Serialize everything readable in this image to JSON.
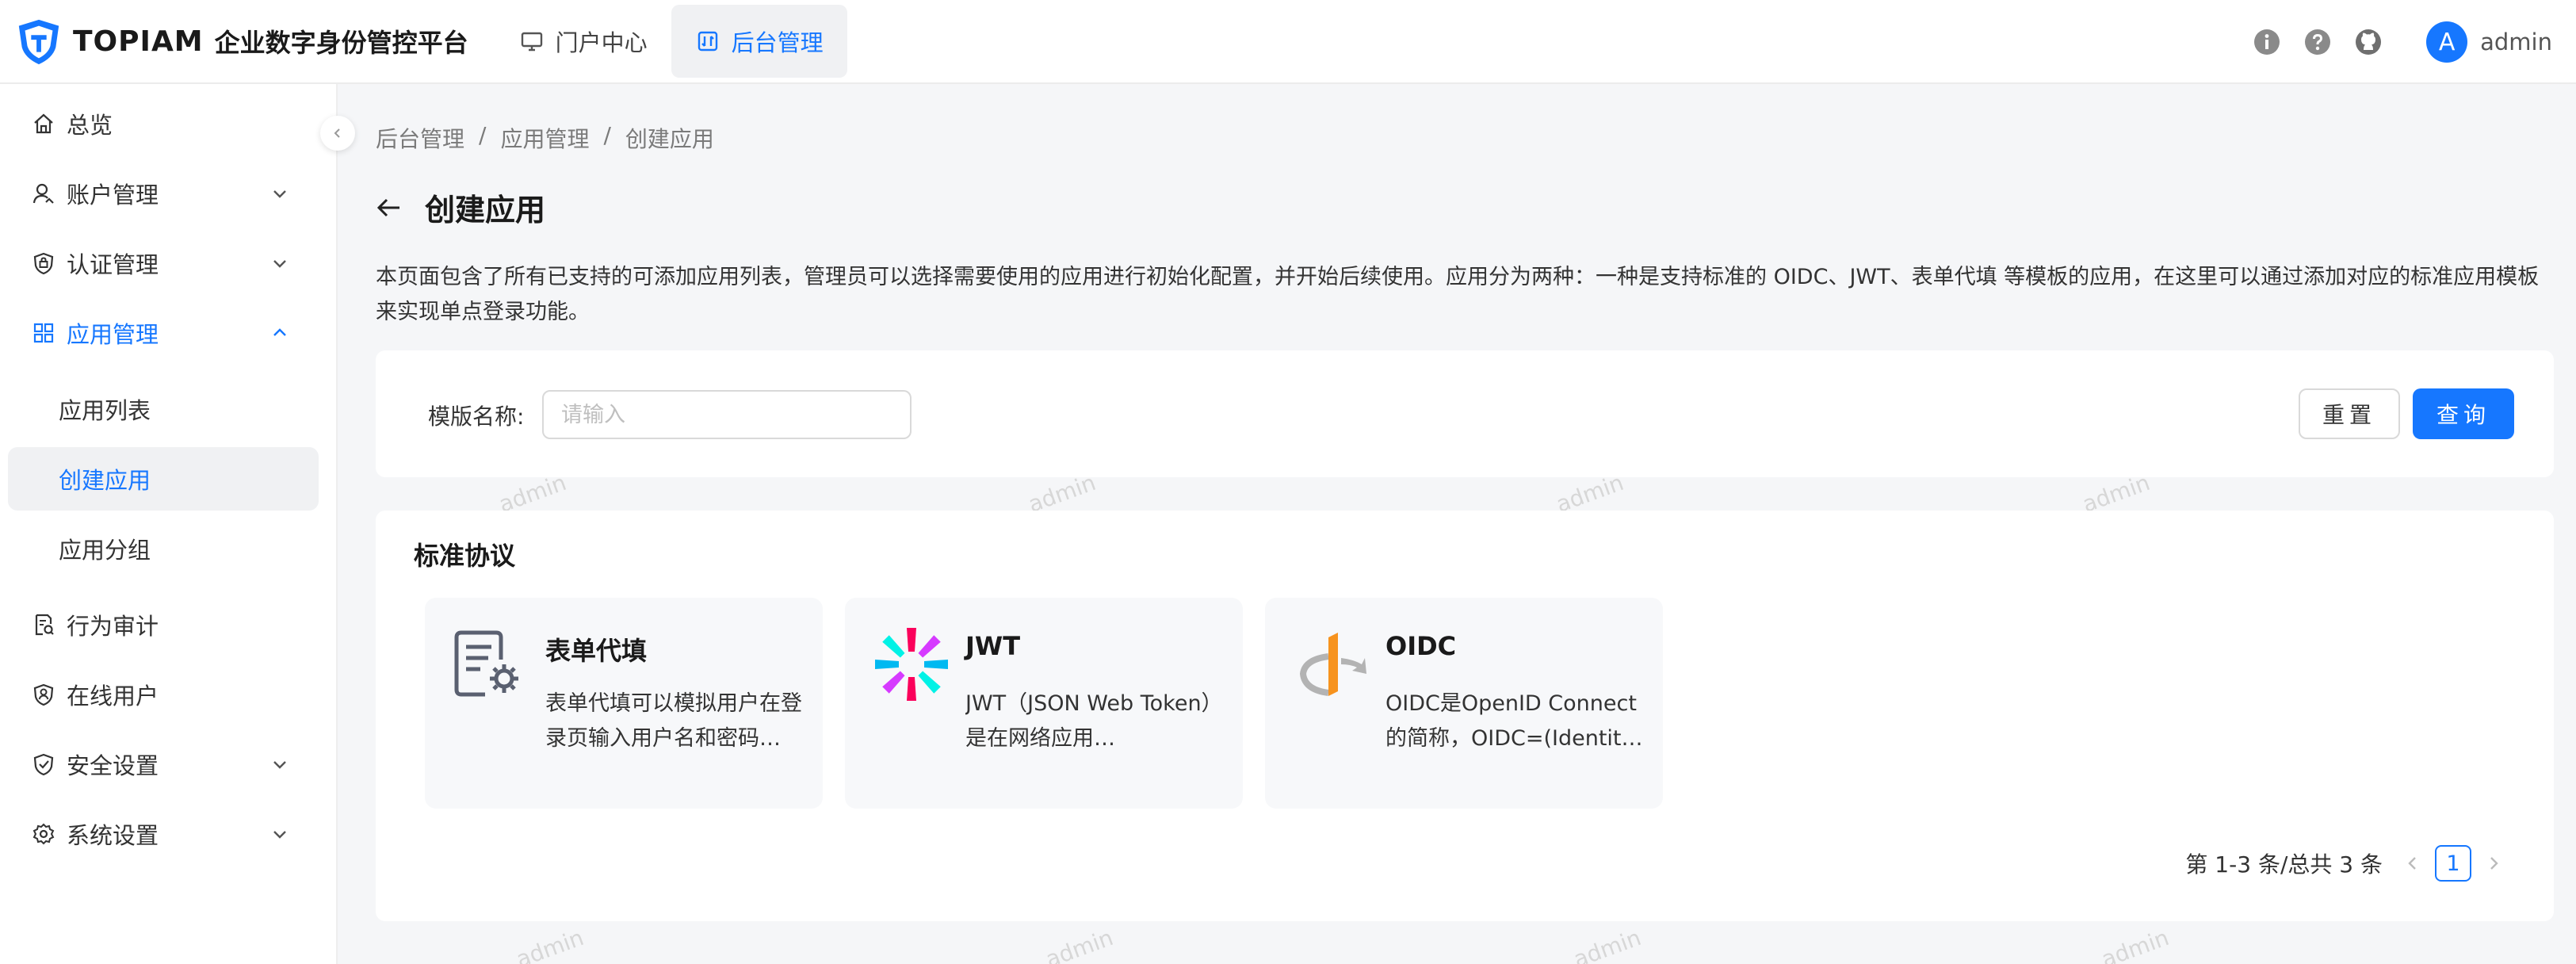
{
  "header": {
    "brand": "TOPIAM",
    "product": "企业数字身份管控平台",
    "nav": [
      {
        "label": "门户中心",
        "icon": "monitor-icon",
        "active": false
      },
      {
        "label": "后台管理",
        "icon": "console-icon",
        "active": true
      }
    ],
    "icons": [
      "info-icon",
      "help-icon",
      "github-icon"
    ],
    "user": {
      "avatar_letter": "A",
      "name": "admin"
    }
  },
  "sidebar": {
    "items": [
      {
        "label": "总览",
        "icon": "home-icon"
      },
      {
        "label": "账户管理",
        "icon": "user-icon"
      },
      {
        "label": "认证管理",
        "icon": "shield-icon"
      },
      {
        "label": "应用管理",
        "icon": "apps-icon"
      },
      {
        "label": "应用列表"
      },
      {
        "label": "创建应用"
      },
      {
        "label": "应用分组"
      },
      {
        "label": "行为审计",
        "icon": "audit-icon"
      },
      {
        "label": "在线用户",
        "icon": "online-user-icon"
      },
      {
        "label": "安全设置",
        "icon": "security-icon"
      },
      {
        "label": "系统设置",
        "icon": "gear-icon"
      }
    ]
  },
  "breadcrumb": [
    "后台管理",
    "应用管理",
    "创建应用"
  ],
  "breadcrumb_sep": "/",
  "page": {
    "title": "创建应用",
    "description": "本页面包含了所有已支持的可添加应用列表，管理员可以选择需要使用的应用进行初始化配置，并开始后续使用。应用分为两种：一种是支持标准的 OIDC、JWT、表单代填 等模板的应用，在这里可以通过添加对应的标准应用模板来实现单点登录功能。"
  },
  "filter": {
    "label": "模版名称:",
    "placeholder": "请输入",
    "value": "",
    "reset_label": "重置",
    "query_label": "查询"
  },
  "section": {
    "title": "标准协议",
    "templates": [
      {
        "name": "表单代填",
        "icon": "form-fill-icon",
        "description": "表单代填可以模拟用户在登录页输入用户名和密码…"
      },
      {
        "name": "JWT",
        "icon": "jwt-icon",
        "description": "JWT（JSON Web Token）是在网络应用…"
      },
      {
        "name": "OIDC",
        "icon": "openid-icon",
        "description": "OIDC是OpenID Connect的简称，OIDC=(Identit…"
      }
    ]
  },
  "pagination": {
    "summary": "第 1-3 条/总共 3 条",
    "current_page": "1"
  },
  "watermark": "admin",
  "colors": {
    "primary": "#1677ff",
    "background": "#f5f6f8",
    "card": "#ffffff",
    "template_bg": "#f7f8fa"
  }
}
